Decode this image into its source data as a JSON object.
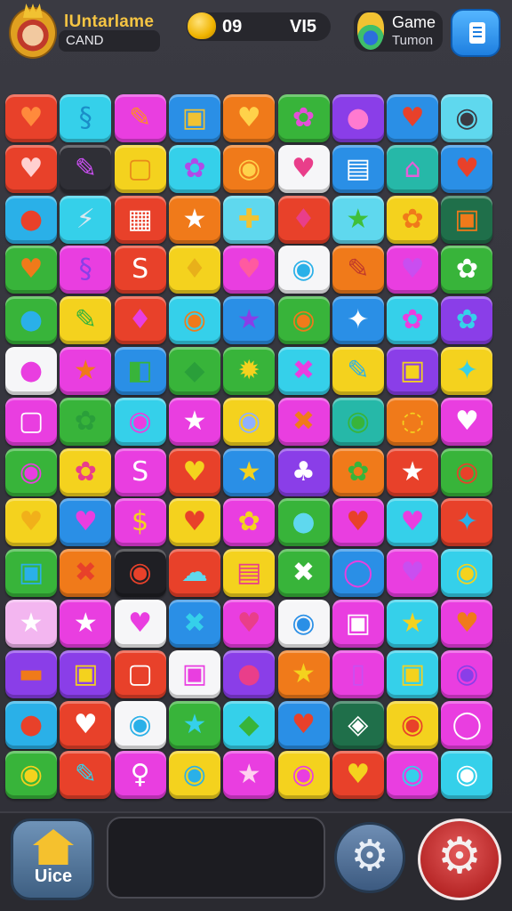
{
  "header": {
    "player_name": "lUntarlame",
    "player_sub": "CAND",
    "score_left": "09",
    "score_right": "VI5",
    "game_title": "Game",
    "game_sub": "Tumon"
  },
  "footer": {
    "home_label": "Uice"
  },
  "board": {
    "rows": [
      [
        {
          "c": "#e8412a",
          "g": "♥",
          "gc": "#ff8a3c"
        },
        {
          "c": "#35d0ea",
          "g": "§",
          "gc": "#1a8ec8"
        },
        {
          "c": "#e93ee0",
          "g": "✎",
          "gc": "#ff8a2a"
        },
        {
          "c": "#2a8fe6",
          "g": "▣",
          "gc": "#f1c232"
        },
        {
          "c": "#f07a1a",
          "g": "♥",
          "gc": "#ffd24a"
        },
        {
          "c": "#38b43a",
          "g": "✿",
          "gc": "#e44fd8"
        },
        {
          "c": "#8a3ee8",
          "g": "●",
          "gc": "#ff7ad0"
        },
        {
          "c": "#2a8fe6",
          "g": "♥",
          "gc": "#e8412a"
        },
        {
          "c": "#5fd8ee",
          "g": "◉",
          "gc": "#3a3a42"
        }
      ],
      [
        {
          "c": "#e8412a",
          "g": "♥",
          "gc": "#ffd0d0"
        },
        {
          "c": "#2f2f36",
          "g": "✎",
          "gc": "#c94ef0"
        },
        {
          "c": "#f4d21e",
          "g": "▢",
          "gc": "#e88a1a"
        },
        {
          "c": "#35d0ea",
          "g": "✿",
          "gc": "#b04be8"
        },
        {
          "c": "#f07a1a",
          "g": "◉",
          "gc": "#ffd24a"
        },
        {
          "c": "#f6f6f8",
          "g": "♥",
          "gc": "#e93e8a"
        },
        {
          "c": "#2a8fe6",
          "g": "▤",
          "gc": "#ffffff"
        },
        {
          "c": "#26b8a8",
          "g": "⌂",
          "gc": "#e45fd8"
        },
        {
          "c": "#2a8fe6",
          "g": "♥",
          "gc": "#e8412a"
        }
      ],
      [
        {
          "c": "#2ab0e8",
          "g": "●",
          "gc": "#e8412a"
        },
        {
          "c": "#35d0ea",
          "g": "⚡",
          "gc": "#d8e8f0"
        },
        {
          "c": "#e8412a",
          "g": "▦",
          "gc": "#ffffff"
        },
        {
          "c": "#f07a1a",
          "g": "★",
          "gc": "#ffffff"
        },
        {
          "c": "#5fd8ee",
          "g": "✚",
          "gc": "#f1c232"
        },
        {
          "c": "#e8412a",
          "g": "♦",
          "gc": "#e93e8a"
        },
        {
          "c": "#5fd8ee",
          "g": "★",
          "gc": "#3fbf3a"
        },
        {
          "c": "#f4d21e",
          "g": "✿",
          "gc": "#f07a1a"
        },
        {
          "c": "#1f6f4a",
          "g": "▣",
          "gc": "#f07a1a"
        }
      ],
      [
        {
          "c": "#38b43a",
          "g": "♥",
          "gc": "#f07a1a"
        },
        {
          "c": "#e93ee0",
          "g": "§",
          "gc": "#8a3ee8"
        },
        {
          "c": "#e8412a",
          "g": "S",
          "gc": "#ffffff"
        },
        {
          "c": "#f4d21e",
          "g": "♦",
          "gc": "#e8b01a"
        },
        {
          "c": "#e93ee0",
          "g": "♥",
          "gc": "#ff5aa0"
        },
        {
          "c": "#f6f6f8",
          "g": "◉",
          "gc": "#2ab0e8"
        },
        {
          "c": "#f07a1a",
          "g": "✎",
          "gc": "#c0392b"
        },
        {
          "c": "#e93ee0",
          "g": "♥",
          "gc": "#c94ef0"
        },
        {
          "c": "#38b43a",
          "g": "✿",
          "gc": "#ffffff"
        }
      ],
      [
        {
          "c": "#38b43a",
          "g": "●",
          "gc": "#2ab0e8"
        },
        {
          "c": "#f4d21e",
          "g": "✎",
          "gc": "#38b43a"
        },
        {
          "c": "#e8412a",
          "g": "♦",
          "gc": "#e93ee0"
        },
        {
          "c": "#35d0ea",
          "g": "◉",
          "gc": "#f07a1a"
        },
        {
          "c": "#2a8fe6",
          "g": "★",
          "gc": "#8a3ee8"
        },
        {
          "c": "#38b43a",
          "g": "◉",
          "gc": "#f07a1a"
        },
        {
          "c": "#2a8fe6",
          "g": "✦",
          "gc": "#ffffff"
        },
        {
          "c": "#35d0ea",
          "g": "✿",
          "gc": "#e93ee0"
        },
        {
          "c": "#8a3ee8",
          "g": "✿",
          "gc": "#35d0ea"
        }
      ],
      [
        {
          "c": "#f6f6f8",
          "g": "●",
          "gc": "#e93ee0"
        },
        {
          "c": "#e93ee0",
          "g": "★",
          "gc": "#f07a1a"
        },
        {
          "c": "#2a8fe6",
          "g": "◧",
          "gc": "#38b43a"
        },
        {
          "c": "#38b43a",
          "g": "◆",
          "gc": "#2a9f3a"
        },
        {
          "c": "#38b43a",
          "g": "✹",
          "gc": "#f4d21e"
        },
        {
          "c": "#35d0ea",
          "g": "✖",
          "gc": "#e93ee0"
        },
        {
          "c": "#f4d21e",
          "g": "✎",
          "gc": "#2ab0e8"
        },
        {
          "c": "#8a3ee8",
          "g": "▣",
          "gc": "#f4d21e"
        },
        {
          "c": "#f4d21e",
          "g": "✦",
          "gc": "#35d0ea"
        }
      ],
      [
        {
          "c": "#e93ee0",
          "g": "▢",
          "gc": "#ffffff"
        },
        {
          "c": "#38b43a",
          "g": "✿",
          "gc": "#2a9f3a"
        },
        {
          "c": "#35d0ea",
          "g": "◉",
          "gc": "#e93ee0"
        },
        {
          "c": "#e93ee0",
          "g": "★",
          "gc": "#ffffff"
        },
        {
          "c": "#f4d21e",
          "g": "◉",
          "gc": "#8fb0ff"
        },
        {
          "c": "#e93ee0",
          "g": "✖",
          "gc": "#f07a1a"
        },
        {
          "c": "#26b8a8",
          "g": "◉",
          "gc": "#38b43a"
        },
        {
          "c": "#f07a1a",
          "g": "◌",
          "gc": "#f4d21e"
        },
        {
          "c": "#e93ee0",
          "g": "♥",
          "gc": "#ffffff"
        }
      ],
      [
        {
          "c": "#38b43a",
          "g": "◉",
          "gc": "#e93ee0"
        },
        {
          "c": "#f4d21e",
          "g": "✿",
          "gc": "#e93e8a"
        },
        {
          "c": "#e93ee0",
          "g": "S",
          "gc": "#ffffff"
        },
        {
          "c": "#e8412a",
          "g": "♥",
          "gc": "#f4d21e"
        },
        {
          "c": "#2a8fe6",
          "g": "★",
          "gc": "#f4d21e"
        },
        {
          "c": "#8a3ee8",
          "g": "♣",
          "gc": "#ffffff"
        },
        {
          "c": "#f07a1a",
          "g": "✿",
          "gc": "#38b43a"
        },
        {
          "c": "#e8412a",
          "g": "★",
          "gc": "#ffffff"
        },
        {
          "c": "#38b43a",
          "g": "◉",
          "gc": "#e8412a"
        }
      ],
      [
        {
          "c": "#f4d21e",
          "g": "♥",
          "gc": "#f1b01a"
        },
        {
          "c": "#2a8fe6",
          "g": "♥",
          "gc": "#e93ee0"
        },
        {
          "c": "#e93ee0",
          "g": "$",
          "gc": "#f4d21e"
        },
        {
          "c": "#f4d21e",
          "g": "♥",
          "gc": "#e8412a"
        },
        {
          "c": "#e93ee0",
          "g": "✿",
          "gc": "#f4d21e"
        },
        {
          "c": "#38b43a",
          "g": "●",
          "gc": "#5fd8ee"
        },
        {
          "c": "#e93ee0",
          "g": "♥",
          "gc": "#e8412a"
        },
        {
          "c": "#35d0ea",
          "g": "♥",
          "gc": "#e93ee0"
        },
        {
          "c": "#e8412a",
          "g": "✦",
          "gc": "#2ab0e8"
        }
      ],
      [
        {
          "c": "#38b43a",
          "g": "▣",
          "gc": "#2ab0e8"
        },
        {
          "c": "#f07a1a",
          "g": "✖",
          "gc": "#e8412a"
        },
        {
          "c": "#1f1f24",
          "g": "◉",
          "gc": "#e8412a"
        },
        {
          "c": "#e8412a",
          "g": "☁",
          "gc": "#5fd8ee"
        },
        {
          "c": "#f4d21e",
          "g": "▤",
          "gc": "#e93e8a"
        },
        {
          "c": "#38b43a",
          "g": "✖",
          "gc": "#ffffff"
        },
        {
          "c": "#2a8fe6",
          "g": "◯",
          "gc": "#e93ee0"
        },
        {
          "c": "#e93ee0",
          "g": "♥",
          "gc": "#c94ef0"
        },
        {
          "c": "#35d0ea",
          "g": "◉",
          "gc": "#f4d21e"
        }
      ],
      [
        {
          "c": "#f3b6f0",
          "g": "★",
          "gc": "#ffffff"
        },
        {
          "c": "#e93ee0",
          "g": "★",
          "gc": "#ffffff"
        },
        {
          "c": "#f6f6f8",
          "g": "♥",
          "gc": "#e93ee0"
        },
        {
          "c": "#2a8fe6",
          "g": "✖",
          "gc": "#35d0ea"
        },
        {
          "c": "#e93ee0",
          "g": "♥",
          "gc": "#e93e8a"
        },
        {
          "c": "#f6f6f8",
          "g": "◉",
          "gc": "#2a8fe6"
        },
        {
          "c": "#e93ee0",
          "g": "▣",
          "gc": "#ffffff"
        },
        {
          "c": "#35d0ea",
          "g": "★",
          "gc": "#f4d21e"
        },
        {
          "c": "#e93ee0",
          "g": "♥",
          "gc": "#f07a1a"
        }
      ],
      [
        {
          "c": "#8a3ee8",
          "g": "▬",
          "gc": "#f07a1a"
        },
        {
          "c": "#8a3ee8",
          "g": "▣",
          "gc": "#f4d21e"
        },
        {
          "c": "#e8412a",
          "g": "▢",
          "gc": "#ffffff"
        },
        {
          "c": "#f6f6f8",
          "g": "▣",
          "gc": "#e93ee0"
        },
        {
          "c": "#8a3ee8",
          "g": "●",
          "gc": "#e93e8a"
        },
        {
          "c": "#f07a1a",
          "g": "★",
          "gc": "#f4d21e"
        },
        {
          "c": "#e93ee0",
          "g": "▯",
          "gc": "#c94ef0"
        },
        {
          "c": "#35d0ea",
          "g": "▣",
          "gc": "#f4d21e"
        },
        {
          "c": "#e93ee0",
          "g": "◉",
          "gc": "#8a3ee8"
        }
      ],
      [
        {
          "c": "#2ab0e8",
          "g": "●",
          "gc": "#e8412a"
        },
        {
          "c": "#e8412a",
          "g": "♥",
          "gc": "#ffffff"
        },
        {
          "c": "#f6f6f8",
          "g": "◉",
          "gc": "#2ab0e8"
        },
        {
          "c": "#38b43a",
          "g": "★",
          "gc": "#35d0ea"
        },
        {
          "c": "#35d0ea",
          "g": "◆",
          "gc": "#38b43a"
        },
        {
          "c": "#2a8fe6",
          "g": "♥",
          "gc": "#e8412a"
        },
        {
          "c": "#1f6f4a",
          "g": "◈",
          "gc": "#ffffff"
        },
        {
          "c": "#f4d21e",
          "g": "◉",
          "gc": "#e8412a"
        },
        {
          "c": "#e93ee0",
          "g": "◯",
          "gc": "#ffffff"
        }
      ],
      [
        {
          "c": "#38b43a",
          "g": "◉",
          "gc": "#f4d21e"
        },
        {
          "c": "#e8412a",
          "g": "✎",
          "gc": "#35d0ea"
        },
        {
          "c": "#e93ee0",
          "g": "♀",
          "gc": "#ffffff"
        },
        {
          "c": "#f4d21e",
          "g": "◉",
          "gc": "#2ab0e8"
        },
        {
          "c": "#e93ee0",
          "g": "★",
          "gc": "#ffd0f0"
        },
        {
          "c": "#f4d21e",
          "g": "◉",
          "gc": "#e93ee0"
        },
        {
          "c": "#e8412a",
          "g": "♥",
          "gc": "#f4d21e"
        },
        {
          "c": "#e93ee0",
          "g": "◉",
          "gc": "#35d0ea"
        },
        {
          "c": "#35d0ea",
          "g": "◉",
          "gc": "#ffffff"
        }
      ]
    ]
  }
}
